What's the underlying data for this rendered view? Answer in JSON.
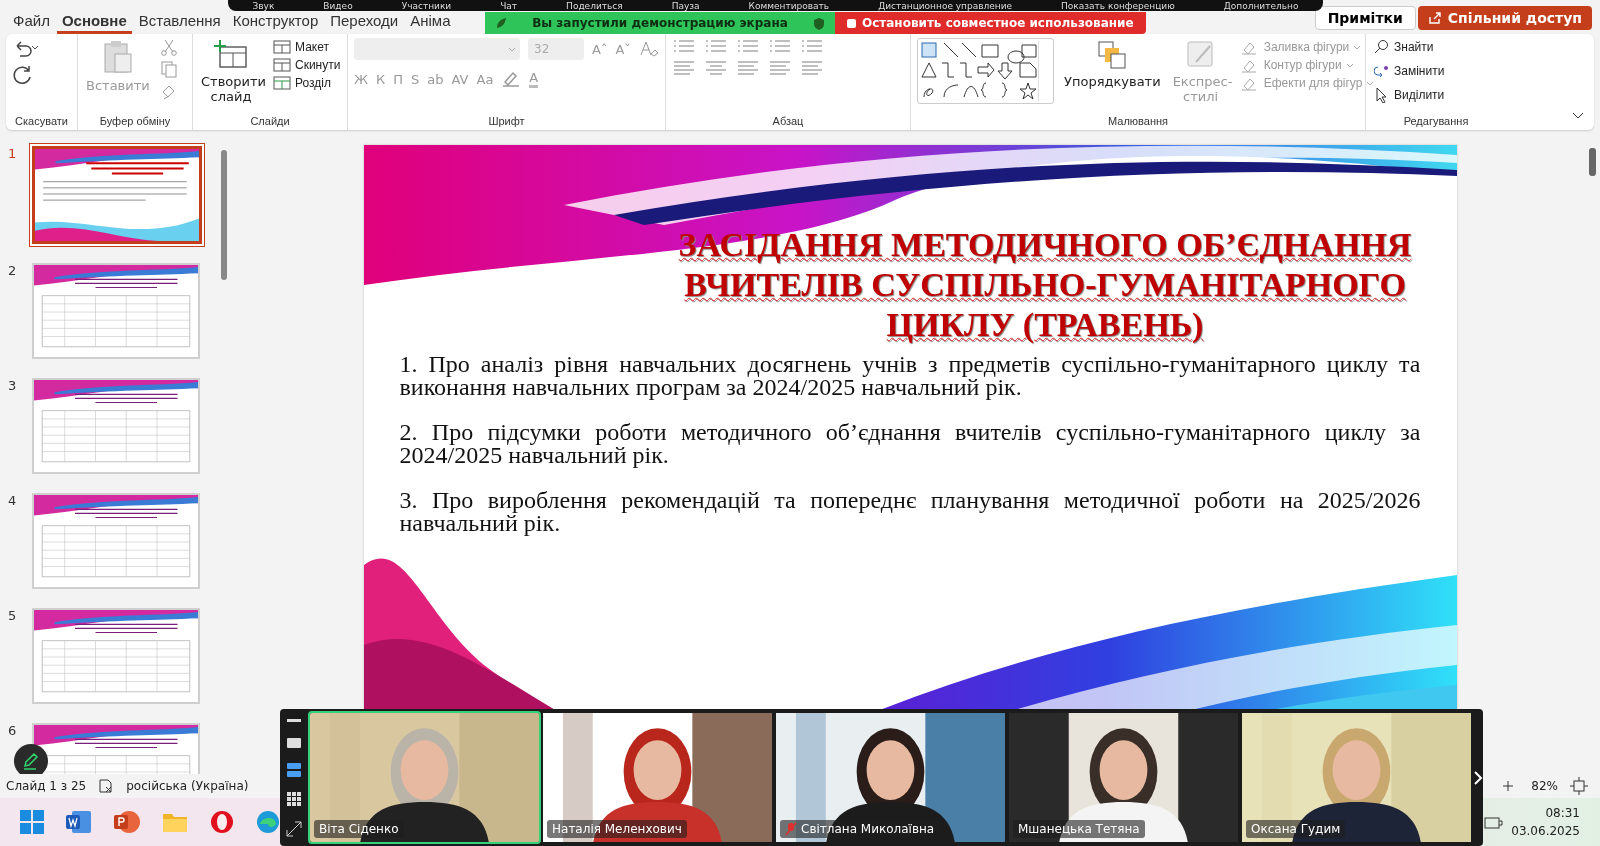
{
  "meeting_toolbar": {
    "items": [
      "Звук",
      "Видео",
      "Участники",
      "Чат",
      "Поделиться",
      "Пауза",
      "Комментировать",
      "Дистанционное управление",
      "Показать конференцию",
      "Дополнительно"
    ]
  },
  "share_banner": {
    "message": "Вы запустили демонстрацию экрана",
    "stop_label": "Остановить совместное использование"
  },
  "ribbon_tabs": [
    {
      "label": "Файл",
      "selected": false
    },
    {
      "label": "Основне",
      "selected": true
    },
    {
      "label": "Вставлення",
      "selected": false
    },
    {
      "label": "Конструктор",
      "selected": false
    },
    {
      "label": "Переходи",
      "selected": false
    },
    {
      "label": "Аніма",
      "selected": false
    }
  ],
  "header_buttons": {
    "notes": "Примітки",
    "share": "Спільний доступ"
  },
  "ribbon": {
    "undo": {
      "label": "Скасувати"
    },
    "clipboard": {
      "label": "Буфер обміну",
      "paste": "Вставити",
      "disabled": true
    },
    "slides": {
      "label": "Слайди",
      "new_slide": "Створити слайд",
      "items": [
        "Макет",
        "Скинути",
        "Розділ"
      ]
    },
    "font": {
      "label": "Шрифт",
      "size_placeholder": "32",
      "disabled": true,
      "size_buttons": [
        "Aˆ",
        "Aˇ"
      ],
      "format_buttons": [
        "Ж",
        "К",
        "П",
        "S",
        "ab",
        "AV",
        "Aa"
      ],
      "color_button": "A"
    },
    "paragraph": {
      "label": "Абзац"
    },
    "drawing": {
      "label": "Малювання",
      "arrange": "Упорядкувати",
      "quick_styles": "Експрес-стилі",
      "styles_disabled": true,
      "items": [
        "Заливка фігури",
        "Контур фігури",
        "Ефекти для фігур"
      ]
    },
    "editing": {
      "label": "Редагування",
      "items": [
        "Знайти",
        "Замінити",
        "Виділити"
      ]
    }
  },
  "slides_panel": {
    "slides": [
      {
        "number": "1",
        "selected": true
      },
      {
        "number": "2",
        "selected": false
      },
      {
        "number": "3",
        "selected": false
      },
      {
        "number": "4",
        "selected": false
      },
      {
        "number": "5",
        "selected": false
      },
      {
        "number": "6",
        "selected": false
      }
    ]
  },
  "slide": {
    "title": "ЗАСІДАННЯ МЕТОДИЧНОГО ОБ’ЄДНАННЯ ВЧИТЕЛІВ СУСПІЛЬНО-ГУМАНІТАРНОГО ЦИКЛУ (ТРАВЕНЬ)",
    "items": [
      "1. Про аналіз рівня навчальних досягнень учнів з предметів суспільно-гуманітарного циклу та виконання навчальних програм за 2024/2025 навчальний рік.",
      "2. Про підсумки роботи методичного об’єднання вчителів суспільно-гуманітарного циклу за 2024/2025 навчальний рік.",
      "3. Про вироблення рекомендацій та попереднє планування методичної роботи на 2025/2026 навчальний рік."
    ]
  },
  "video_strip": {
    "participants": [
      {
        "name": "Віта Сіденко",
        "selected": true,
        "muted": false
      },
      {
        "name": "Наталія Меленхович",
        "selected": false,
        "muted": false
      },
      {
        "name": "Світлана Миколаївна",
        "selected": false,
        "muted": true
      },
      {
        "name": "Мшанецька Тетяна",
        "selected": false,
        "muted": false
      },
      {
        "name": "Оксана Гудим",
        "selected": false,
        "muted": false
      }
    ]
  },
  "status_bar": {
    "slide_position": "Слайд 1 з 25",
    "language": "російська (Україна)",
    "zoom": "82%"
  },
  "taskbar": {
    "time": "08:31",
    "date": "03.06.2025"
  }
}
